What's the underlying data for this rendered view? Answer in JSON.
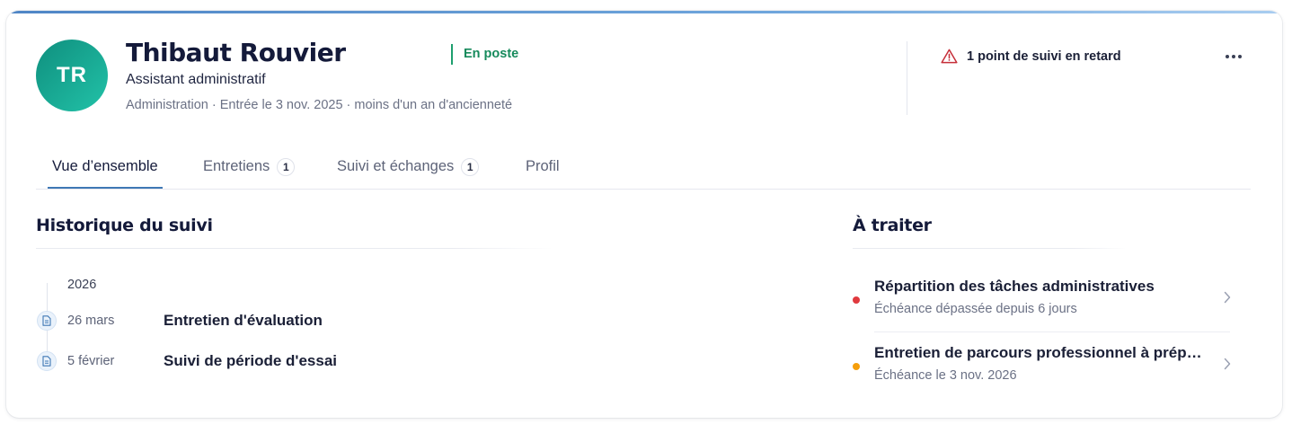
{
  "employee": {
    "initials": "TR",
    "name": "Thibaut Rouvier",
    "role": "Assistant administratif",
    "meta": "Administration · Entrée le 3 nov. 2025 · moins d'un an d'ancienneté",
    "status": "En poste"
  },
  "alert": {
    "text": "1 point de suivi en retard",
    "icon": "warning-triangle-icon",
    "color": "#c62f3a"
  },
  "more_menu": {
    "icon": "more-horizontal-icon"
  },
  "tabs": [
    {
      "label": "Vue d’ensemble",
      "count": null,
      "active": true
    },
    {
      "label": "Entretiens",
      "count": "1",
      "active": false
    },
    {
      "label": "Suivi et échanges",
      "count": "1",
      "active": false
    },
    {
      "label": "Profil",
      "count": null,
      "active": false
    }
  ],
  "history": {
    "title": "Historique du suivi",
    "year": "2026",
    "items": [
      {
        "date": "26 mars",
        "title": "Entretien d'évaluation",
        "icon": "document-icon"
      },
      {
        "date": "5 février",
        "title": "Suivi de période d'essai",
        "icon": "document-icon"
      }
    ]
  },
  "todo": {
    "title": "À traiter",
    "items": [
      {
        "title": "Répartition des tâches administratives",
        "subtitle": "Échéance dépassée depuis 6 jours",
        "dot_color": "#e0393e"
      },
      {
        "title": "Entretien de parcours professionnel à préparer",
        "subtitle": "Échéance le 3 nov. 2026",
        "dot_color": "#f59e0b"
      }
    ]
  },
  "colors": {
    "accent": "#3f78b5",
    "status_green": "#168a5c",
    "avatar_start": "#0f8f7e",
    "avatar_end": "#22c2a8"
  }
}
